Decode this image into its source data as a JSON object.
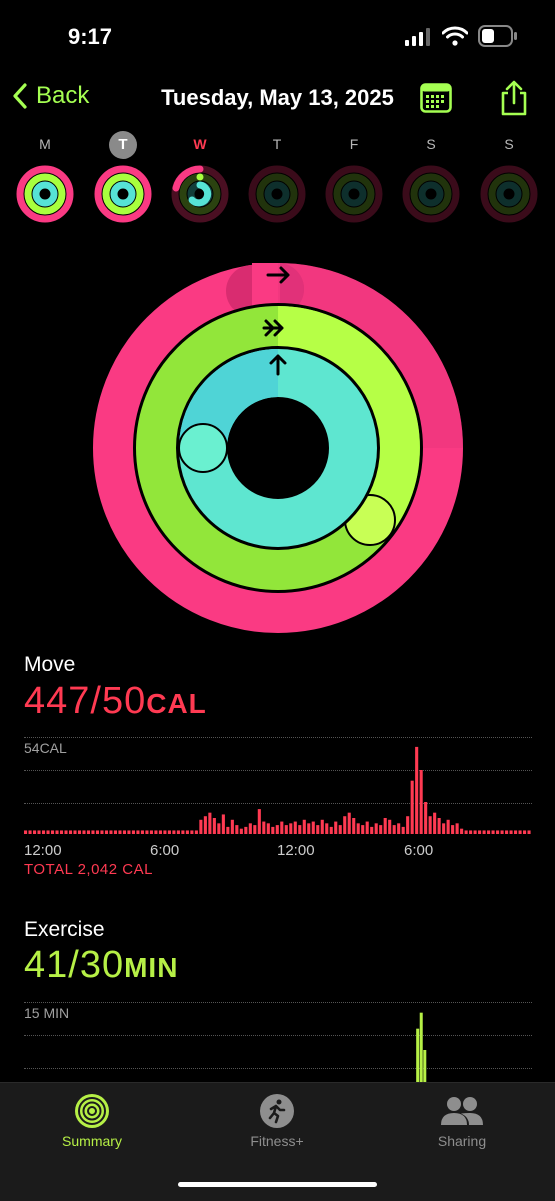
{
  "status": {
    "time": "9:17"
  },
  "nav": {
    "back_label": "Back",
    "title": "Tuesday, May 13, 2025"
  },
  "days": [
    {
      "label": "M",
      "state": "past"
    },
    {
      "label": "T",
      "state": "selected"
    },
    {
      "label": "W",
      "state": "today"
    },
    {
      "label": "T",
      "state": "future"
    },
    {
      "label": "F",
      "state": "future"
    },
    {
      "label": "S",
      "state": "future"
    },
    {
      "label": "S",
      "state": "future"
    }
  ],
  "rings": {
    "move": {
      "value": 447,
      "goal": 50,
      "color": "#fa3a83"
    },
    "exercise": {
      "value": 41,
      "goal": 30,
      "color": "#a8ff3e"
    },
    "stand": {
      "color": "#56e3d6"
    }
  },
  "move": {
    "title": "Move",
    "value": "447/50",
    "unit": "CAL",
    "chart_max_label": "54CAL",
    "x_ticks": [
      "12:00",
      "6:00",
      "12:00",
      "6:00"
    ],
    "total": "TOTAL 2,042 CAL",
    "color": "#ff3a52"
  },
  "exercise": {
    "title": "Exercise",
    "value": "41/30",
    "unit": "MIN",
    "chart_max_label": "15 MIN",
    "color": "#b6f046"
  },
  "chart_data": [
    {
      "type": "bar",
      "title": "Move",
      "ylabel": "54CAL",
      "x_ticks": [
        "12:00",
        "6:00",
        "12:00",
        "6:00"
      ],
      "ylim": [
        0,
        54
      ],
      "values": [
        2,
        2,
        2,
        2,
        2,
        2,
        2,
        2,
        2,
        2,
        2,
        2,
        2,
        2,
        2,
        2,
        2,
        2,
        2,
        2,
        2,
        2,
        2,
        2,
        2,
        2,
        2,
        2,
        2,
        2,
        2,
        2,
        2,
        2,
        2,
        2,
        2,
        2,
        2,
        8,
        10,
        12,
        9,
        6,
        11,
        4,
        8,
        5,
        3,
        4,
        6,
        5,
        14,
        7,
        6,
        4,
        5,
        7,
        5,
        6,
        7,
        5,
        8,
        6,
        7,
        5,
        8,
        6,
        4,
        7,
        5,
        10,
        12,
        9,
        6,
        5,
        7,
        4,
        6,
        5,
        9,
        8,
        5,
        6,
        4,
        10,
        30,
        49,
        36,
        18,
        10,
        12,
        9,
        6,
        8,
        5,
        6,
        3,
        2,
        2,
        2,
        2,
        2,
        2,
        2,
        2,
        2,
        2,
        2,
        2,
        2,
        2,
        2
      ],
      "color": "#ff3a52"
    },
    {
      "type": "bar",
      "title": "Exercise",
      "ylabel": "15 MIN",
      "ylim": [
        0,
        15
      ],
      "values": [
        {
          "x": 0.772,
          "y": 10
        },
        {
          "x": 0.779,
          "y": 13
        },
        {
          "x": 0.786,
          "y": 6
        }
      ],
      "color": "#b6f046"
    }
  ],
  "tabs": [
    {
      "label": "Summary",
      "icon": "activity-rings-icon",
      "active": true
    },
    {
      "label": "Fitness+",
      "icon": "runner-icon",
      "active": false
    },
    {
      "label": "Sharing",
      "icon": "people-icon",
      "active": false
    }
  ]
}
